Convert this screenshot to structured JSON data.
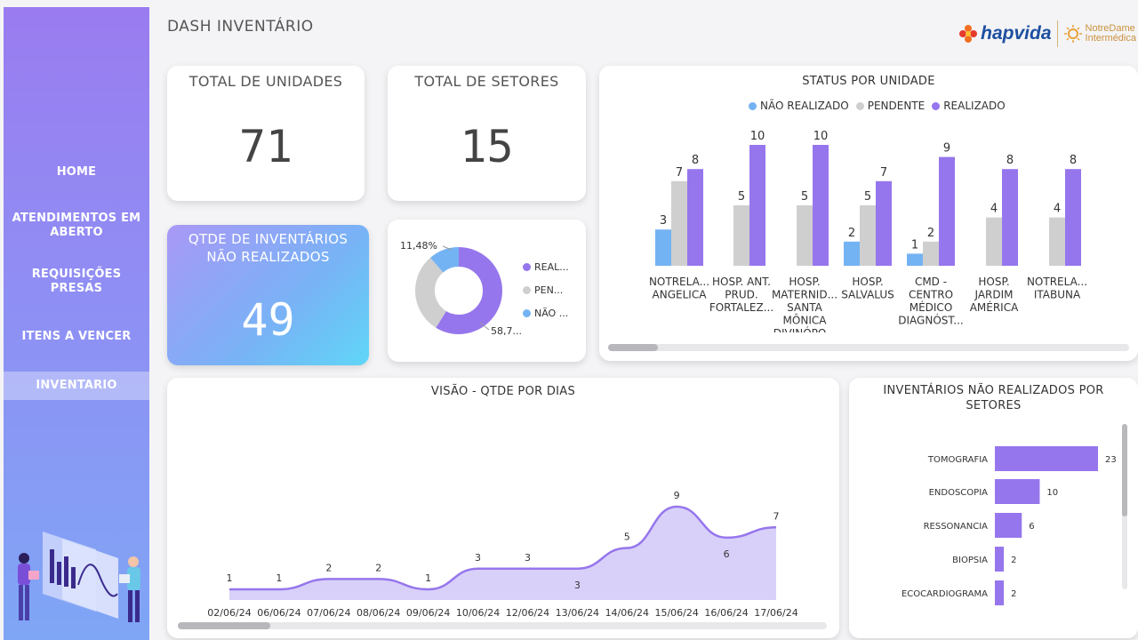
{
  "page": {
    "title": "DASH INVENTÁRIO"
  },
  "logo": {
    "brand_a": "hapvida",
    "brand_b_line1": "NotreDame",
    "brand_b_line2": "Intermédica"
  },
  "colors": {
    "nao_realizado": "#74b3f3",
    "pendente": "#cfcfcf",
    "realizado": "#9676ec",
    "sidebar_top": "#9a7cf0",
    "sidebar_bottom": "#7fa6f5"
  },
  "sidebar": {
    "items": [
      {
        "label": "HOME"
      },
      {
        "label": "ATENDIMENTOS EM\nABERTO"
      },
      {
        "label": "REQUISIÇÕES\nPRESAS"
      },
      {
        "label": "ITENS A VENCER"
      },
      {
        "label": "INVENTARIO"
      }
    ]
  },
  "kpis": {
    "unidades": {
      "title": "TOTAL DE UNIDADES",
      "value": "71"
    },
    "setores": {
      "title": "TOTAL DE SETORES",
      "value": "15"
    },
    "nao_realizados": {
      "title": "QTDE DE INVENTÁRIOS\nNÃO REALIZADOS",
      "value": "49"
    }
  },
  "donut": {
    "legend": [
      "REAL...",
      "PEN...",
      "NÃO ..."
    ],
    "labels": {
      "small": "11,48%",
      "large": "58,7..."
    }
  },
  "status_chart_title": "STATUS POR UNIDADE",
  "line_chart_title": "VISÃO - QTDE POR DIAS",
  "setores_chart_title": "INVENTÁRIOS NÃO REALIZADOS POR\nSETORES",
  "chart_data": [
    {
      "type": "pie",
      "categories": [
        "REALIZADO",
        "PENDENTE",
        "NÃO REALIZADO"
      ],
      "values": [
        58.7,
        29.82,
        11.48
      ],
      "legend_position": "right"
    },
    {
      "type": "bar",
      "title": "STATUS POR UNIDADE",
      "legend": [
        "NÃO REALIZADO",
        "PENDENTE",
        "REALIZADO"
      ],
      "categories": [
        "NOTRELA...\nANGELICA",
        "HOSP. ANT.\nPRUD.\nFORTALEZ...",
        "HOSP.\nMATERNID...\nSANTA\nMÔNICA\nDIVINÓPO...",
        "HOSP.\nSALVALUS",
        "CMD -\nCENTRO\nMÉDICO\nDIAGNÓST...",
        "HOSP.\nJARDIM\nAMÉRICA",
        "NOTRELA...\nITABUNA"
      ],
      "series": [
        {
          "name": "NÃO REALIZADO",
          "values": [
            3,
            null,
            null,
            2,
            1,
            null,
            null
          ]
        },
        {
          "name": "PENDENTE",
          "values": [
            7,
            5,
            5,
            5,
            2,
            4,
            4
          ]
        },
        {
          "name": "REALIZADO",
          "values": [
            8,
            10,
            10,
            7,
            9,
            8,
            8
          ]
        }
      ],
      "ylim": [
        0,
        10
      ]
    },
    {
      "type": "area",
      "title": "VISÃO - QTDE POR DIAS",
      "x": [
        "02/06/24",
        "06/06/24",
        "07/06/24",
        "08/06/24",
        "09/06/24",
        "10/06/24",
        "12/06/24",
        "13/06/24",
        "14/06/24",
        "15/06/24",
        "16/06/24",
        "17/06/24"
      ],
      "values": [
        1,
        1,
        2,
        2,
        1,
        3,
        3,
        3,
        5,
        9,
        6,
        7
      ]
    },
    {
      "type": "bar",
      "orientation": "horizontal",
      "title": "INVENTÁRIOS NÃO REALIZADOS POR\nSETORES",
      "categories": [
        "TOMOGRAFIA",
        "ENDOSCOPIA",
        "RESSONANCIA",
        "BIOPSIA",
        "ECOCARDIOGRAMA"
      ],
      "values": [
        23,
        10,
        6,
        2,
        2
      ]
    }
  ]
}
